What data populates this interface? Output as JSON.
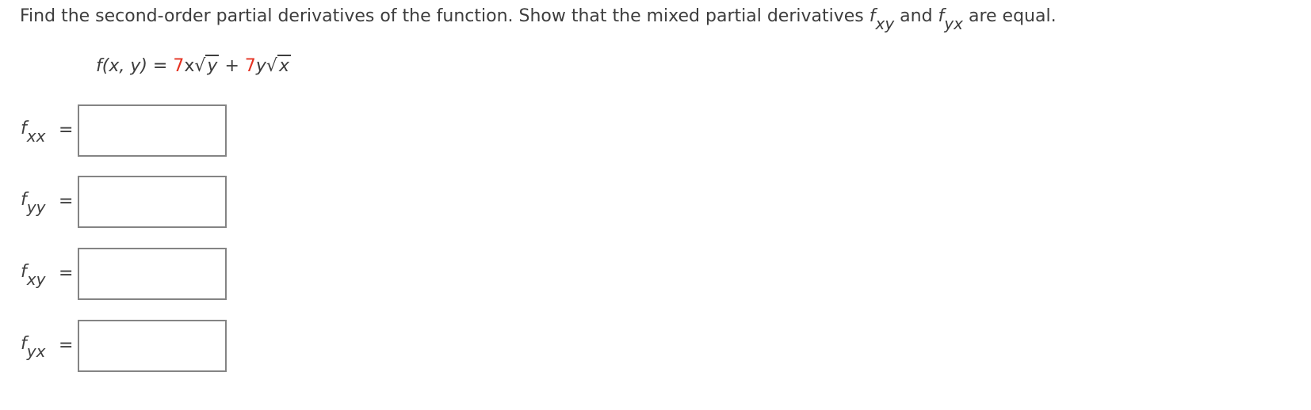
{
  "question": {
    "text_before": "Find the second-order partial derivatives of the function. Show that the mixed partial derivatives ",
    "f1": "f",
    "sub1": "xy",
    "and": " and ",
    "f2": "f",
    "sub2": "yx",
    "text_after": " are equal."
  },
  "function": {
    "lhs": "f(x, y) = ",
    "coef1": "7",
    "var1": "x",
    "rad1": "y",
    "plus": " + ",
    "coef2": "7",
    "var2": "y",
    "rad2": "x",
    "accent_color": "#e53222"
  },
  "answers": [
    {
      "f": "f",
      "sub": "xx",
      "eq": "=",
      "value": ""
    },
    {
      "f": "f",
      "sub": "yy",
      "eq": "=",
      "value": ""
    },
    {
      "f": "f",
      "sub": "xy",
      "eq": "=",
      "value": ""
    },
    {
      "f": "f",
      "sub": "yx",
      "eq": "=",
      "value": ""
    }
  ]
}
